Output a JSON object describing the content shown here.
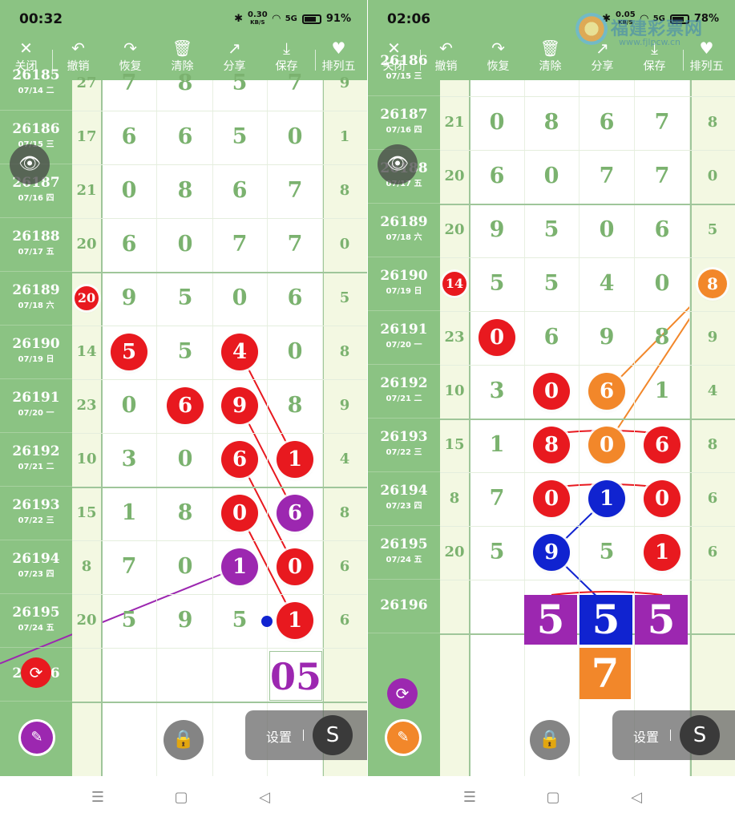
{
  "status_bar": [
    {
      "time": "00:32",
      "net_speed": "0.30",
      "net_unit": "KB/S",
      "signal": "5G",
      "battery": "91%"
    },
    {
      "time": "02:06",
      "net_speed": "0.05",
      "net_unit": "KB/S",
      "signal": "5G",
      "battery": "78%"
    }
  ],
  "toolbar": {
    "close": "关闭",
    "undo": "撤销",
    "redo": "恢复",
    "clear": "清除",
    "share": "分享",
    "save": "保存",
    "mode": "排列五"
  },
  "settings_label": "设置",
  "watermark": {
    "name": "福建彩票网",
    "url": "www.fjlpcw.cn"
  },
  "icons": {
    "close": "close-icon",
    "undo": "undo-icon",
    "redo": "redo-icon",
    "clear": "trash-icon",
    "share": "share-icon",
    "save": "download-icon",
    "mode": "heart-icon",
    "eye": "eye-icon",
    "lock": "lock-icon",
    "pen": "pen-icon",
    "sync": "sync-icon",
    "s": "s-icon"
  },
  "colors": {
    "green": "#8bc383",
    "red": "#e8191f",
    "purple": "#9c27b0",
    "blue": "#1023d0",
    "orange": "#f2872a"
  },
  "left_panel": {
    "rows": [
      {
        "id": "26185",
        "date": "07/14 二",
        "sum": "27",
        "digits": [
          "7",
          "8",
          "5",
          "7"
        ],
        "tail": "9"
      },
      {
        "id": "26186",
        "date": "07/15 三",
        "sum": "17",
        "digits": [
          "6",
          "6",
          "5",
          "0"
        ],
        "tail": "1"
      },
      {
        "id": "26187",
        "date": "07/16 四",
        "sum": "21",
        "digits": [
          "0",
          "8",
          "6",
          "7"
        ],
        "tail": "8"
      },
      {
        "id": "26188",
        "date": "07/17 五",
        "sum": "20",
        "digits": [
          "6",
          "0",
          "7",
          "7"
        ],
        "tail": "0"
      },
      {
        "id": "26189",
        "date": "07/18 六",
        "sum": "20",
        "digits": [
          "9",
          "5",
          "0",
          "6"
        ],
        "tail": "5"
      },
      {
        "id": "26190",
        "date": "07/19 日",
        "sum": "14",
        "digits": [
          "5",
          "5",
          "4",
          "0"
        ],
        "tail": "8"
      },
      {
        "id": "26191",
        "date": "07/20 一",
        "sum": "23",
        "digits": [
          "0",
          "6",
          "9",
          "8"
        ],
        "tail": "9"
      },
      {
        "id": "26192",
        "date": "07/21 二",
        "sum": "10",
        "digits": [
          "3",
          "0",
          "6",
          "1"
        ],
        "tail": "4"
      },
      {
        "id": "26193",
        "date": "07/22 三",
        "sum": "15",
        "digits": [
          "1",
          "8",
          "0",
          "6"
        ],
        "tail": "8"
      },
      {
        "id": "26194",
        "date": "07/23 四",
        "sum": "8",
        "digits": [
          "7",
          "0",
          "1",
          "0"
        ],
        "tail": "6"
      },
      {
        "id": "26195",
        "date": "07/24 五",
        "sum": "20",
        "digits": [
          "5",
          "9",
          "5",
          "1"
        ],
        "tail": "6"
      },
      {
        "id": "26196",
        "date": "",
        "sum": "",
        "digits": [
          "",
          "",
          "",
          ""
        ],
        "tail": ""
      }
    ],
    "prediction": "05"
  },
  "right_panel": {
    "rows": [
      {
        "id": "26186",
        "date": "07/15 三",
        "sum": "",
        "digits": [
          "",
          "",
          "",
          ""
        ],
        "tail": ""
      },
      {
        "id": "26187",
        "date": "07/16 四",
        "sum": "21",
        "digits": [
          "0",
          "8",
          "6",
          "7"
        ],
        "tail": "8"
      },
      {
        "id": "26188",
        "date": "07/17 五",
        "sum": "20",
        "digits": [
          "6",
          "0",
          "7",
          "7"
        ],
        "tail": "0"
      },
      {
        "id": "26189",
        "date": "07/18 六",
        "sum": "20",
        "digits": [
          "9",
          "5",
          "0",
          "6"
        ],
        "tail": "5"
      },
      {
        "id": "26190",
        "date": "07/19 日",
        "sum": "14",
        "digits": [
          "5",
          "5",
          "4",
          "0"
        ],
        "tail": "8"
      },
      {
        "id": "26191",
        "date": "07/20 一",
        "sum": "23",
        "digits": [
          "0",
          "6",
          "9",
          "8"
        ],
        "tail": "9"
      },
      {
        "id": "26192",
        "date": "07/21 二",
        "sum": "10",
        "digits": [
          "3",
          "0",
          "6",
          "1"
        ],
        "tail": "4"
      },
      {
        "id": "26193",
        "date": "07/22 三",
        "sum": "15",
        "digits": [
          "1",
          "8",
          "0",
          "6"
        ],
        "tail": "8"
      },
      {
        "id": "26194",
        "date": "07/23 四",
        "sum": "8",
        "digits": [
          "7",
          "0",
          "1",
          "0"
        ],
        "tail": "6"
      },
      {
        "id": "26195",
        "date": "07/24 五",
        "sum": "20",
        "digits": [
          "5",
          "9",
          "5",
          "1"
        ],
        "tail": "6"
      },
      {
        "id": "26196",
        "date": "",
        "sum": "",
        "digits": [
          "",
          "",
          "",
          ""
        ],
        "tail": ""
      }
    ],
    "prediction_top": [
      "5",
      "5",
      "5"
    ],
    "prediction_bottom": "7"
  }
}
